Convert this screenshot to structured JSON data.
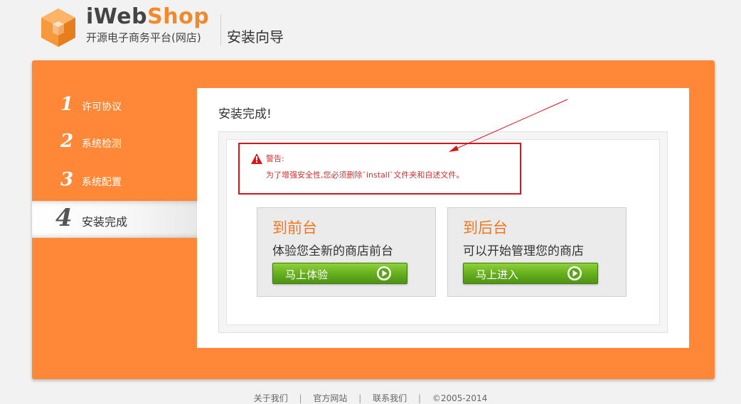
{
  "header": {
    "brand_part1": "iWeb",
    "brand_part2": "Shop",
    "tagline": "开源电子商务平台(网店)",
    "wizard_title": "安装向导"
  },
  "steps": [
    {
      "num": "1",
      "label": "许可协议",
      "active": false
    },
    {
      "num": "2",
      "label": "系统检测",
      "active": false
    },
    {
      "num": "3",
      "label": "系统配置",
      "active": false
    },
    {
      "num": "4",
      "label": "安装完成",
      "active": true
    }
  ],
  "content": {
    "title": "安装完成!",
    "warning": {
      "label": "警告:",
      "text": "为了增强安全性,您必须删除`install`文件夹和自述文件。"
    },
    "cards": [
      {
        "title": "到前台",
        "desc": "体验您全新的商店前台",
        "button": "马上体验"
      },
      {
        "title": "到后台",
        "desc": "可以开始管理您的商店",
        "button": "马上进入"
      }
    ]
  },
  "footer": {
    "links": [
      "关于我们",
      "官方网站",
      "联系我们"
    ],
    "separator": "|",
    "copyright": "©2005-2014"
  },
  "colors": {
    "panel_orange": "#ff8838",
    "brand_orange": "#f08a2c",
    "warning_red": "#d9141a",
    "button_green": "#64ad1e",
    "card_title_orange": "#f5761a"
  },
  "icons": [
    "cube-logo-icon",
    "warning-triangle-icon",
    "play-circle-icon"
  ]
}
